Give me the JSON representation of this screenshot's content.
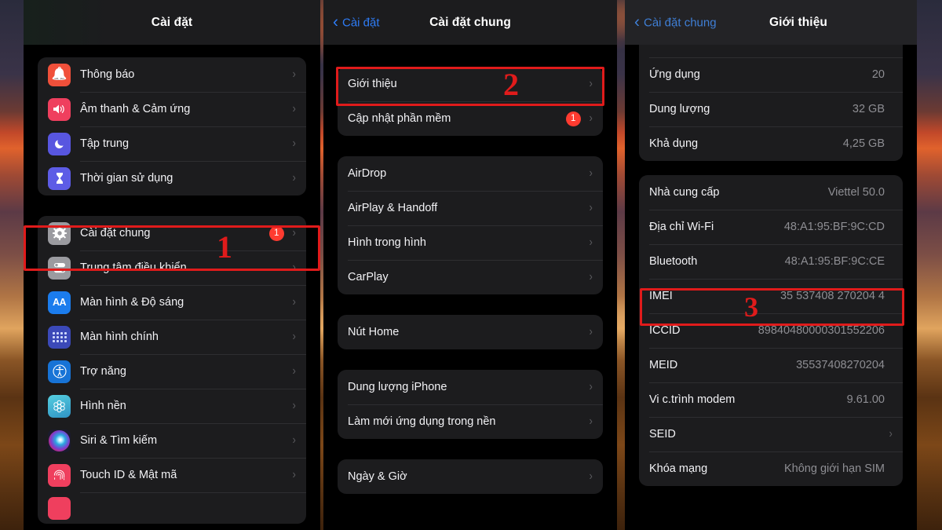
{
  "background": {
    "name": "sunset-desert-wallpaper"
  },
  "colors": {
    "accent_blue": "#2e7cf6",
    "badge_red": "#ff3b30",
    "highlight_red": "#e01b1b",
    "panel_bg": "#000000",
    "group_bg": "#1c1c1e",
    "label": "#f2f2f5",
    "value": "#8e8e93"
  },
  "panel_settings": {
    "nav": {
      "title": "Cài đặt"
    },
    "groups": [
      {
        "rows": [
          {
            "icon": "notifications-icon",
            "icon_color": "#f0503a",
            "label": "Thông báo",
            "chevron": "›"
          },
          {
            "icon": "sounds-haptics-icon",
            "icon_color": "#ef3f5e",
            "label": "Âm thanh & Cảm ứng",
            "chevron": "›"
          },
          {
            "icon": "focus-icon",
            "icon_color": "#5856e0",
            "label": "Tập trung",
            "chevron": "›"
          },
          {
            "icon": "screen-time-icon",
            "icon_color": "#5d5ce6",
            "label": "Thời gian sử dụng",
            "chevron": "›"
          }
        ]
      },
      {
        "rows": [
          {
            "icon": "gear-icon",
            "icon_color": "#8e8e93",
            "label": "Cài đặt chung",
            "badge": "1",
            "chevron": "›"
          },
          {
            "icon": "control-center-icon",
            "icon_color": "#8e8e93",
            "label": "Trung tâm điều khiển",
            "chevron": "›"
          },
          {
            "icon": "display-brightness-icon",
            "icon_color": "#1b7ced",
            "label": "Màn hình & Độ sáng",
            "chevron": "›"
          },
          {
            "icon": "home-screen-icon",
            "icon_color": "#3b49b8",
            "label": "Màn hình chính",
            "chevron": "›"
          },
          {
            "icon": "accessibility-icon",
            "icon_color": "#1773d6",
            "label": "Trợ năng",
            "chevron": "›"
          },
          {
            "icon": "wallpaper-icon",
            "icon_color": "#38b3c9",
            "label": "Hình nền",
            "chevron": "›"
          },
          {
            "icon": "siri-search-icon",
            "icon_color": "#2b2b4a",
            "label": "Siri & Tìm kiếm",
            "chevron": "›"
          },
          {
            "icon": "touch-id-icon",
            "icon_color": "#ef3f5e",
            "label": "Touch ID & Mật mã",
            "chevron": "›"
          }
        ]
      }
    ]
  },
  "panel_general": {
    "nav": {
      "back_label": "Cài đặt",
      "back_chevron": "‹",
      "title": "Cài đặt chung"
    },
    "groups": [
      {
        "rows": [
          {
            "label": "Giới thiệu",
            "chevron": "›"
          },
          {
            "label": "Cập nhật phần mềm",
            "badge": "1",
            "chevron": "›"
          }
        ]
      },
      {
        "rows": [
          {
            "label": "AirDrop",
            "chevron": "›"
          },
          {
            "label": "AirPlay & Handoff",
            "chevron": "›"
          },
          {
            "label": "Hình trong hình",
            "chevron": "›"
          },
          {
            "label": "CarPlay",
            "chevron": "›"
          }
        ]
      },
      {
        "rows": [
          {
            "label": "Nút Home",
            "chevron": "›"
          }
        ]
      },
      {
        "rows": [
          {
            "label": "Dung lượng iPhone",
            "chevron": "›"
          },
          {
            "label": "Làm mới ứng dụng trong nền",
            "chevron": "›"
          }
        ]
      },
      {
        "rows": [
          {
            "label": "Ngày & Giờ",
            "chevron": "›"
          }
        ]
      }
    ]
  },
  "panel_about": {
    "nav": {
      "back_label": "Cài đặt chung",
      "back_chevron": "‹",
      "title": "Giới thiệu"
    },
    "groups": [
      {
        "rows": [
          {
            "label": "Ứng dụng",
            "value": "20"
          },
          {
            "label": "Dung lượng",
            "value": "32 GB"
          },
          {
            "label": "Khả dụng",
            "value": "4,25 GB"
          }
        ]
      },
      {
        "rows": [
          {
            "label": "Nhà cung cấp",
            "value": "Viettel 50.0"
          },
          {
            "label": "Địa chỉ Wi-Fi",
            "value": "48:A1:95:BF:9C:CD"
          },
          {
            "label": "Bluetooth",
            "value": "48:A1:95:BF:9C:CE"
          },
          {
            "label": "IMEI",
            "value": "35 537408 270204 4"
          },
          {
            "label": "ICCID",
            "value": "89840480000301552206"
          },
          {
            "label": "MEID",
            "value": "35537408270204"
          },
          {
            "label": "Vi c.trình modem",
            "value": "9.61.00"
          },
          {
            "label": "SEID",
            "value": "",
            "chevron": "›"
          },
          {
            "label": "Khóa mạng",
            "value": "Không giới hạn SIM"
          }
        ]
      }
    ]
  },
  "annotations": {
    "steps": [
      {
        "number": "1",
        "target": "Cài đặt chung"
      },
      {
        "number": "2",
        "target": "Giới thiệu"
      },
      {
        "number": "3",
        "target": "IMEI"
      }
    ]
  }
}
